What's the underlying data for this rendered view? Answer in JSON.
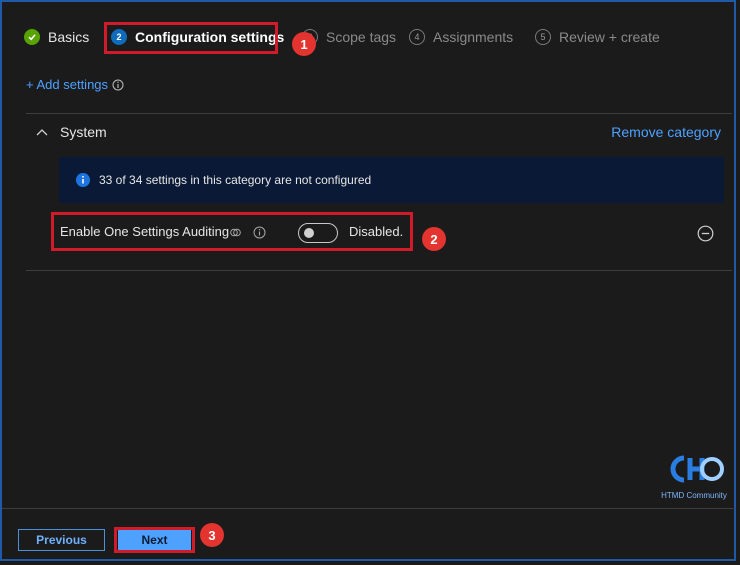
{
  "wizard": {
    "steps": [
      {
        "number": "",
        "label": "Basics",
        "state": "done"
      },
      {
        "number": "2",
        "label": "Configuration settings",
        "state": "active"
      },
      {
        "number": "3",
        "label": "Scope tags",
        "state": "todo"
      },
      {
        "number": "4",
        "label": "Assignments",
        "state": "todo"
      },
      {
        "number": "5",
        "label": "Review + create",
        "state": "todo"
      }
    ]
  },
  "add_settings_label": "+ Add settings",
  "category": {
    "name": "System",
    "remove_label": "Remove category",
    "info_text": "33 of 34 settings in this category are not configured"
  },
  "setting": {
    "name": "Enable One Settings Auditing",
    "toggle_on": false,
    "status_text": "Disabled."
  },
  "annotations": {
    "one": "1",
    "two": "2",
    "three": "3"
  },
  "footer": {
    "previous_label": "Previous",
    "next_label": "Next"
  },
  "watermark": {
    "text": "HTMD Community"
  },
  "colors": {
    "accent": "#0f6cbd",
    "link": "#4ea1ff",
    "highlight": "#d11a2a",
    "done": "#57a300"
  }
}
